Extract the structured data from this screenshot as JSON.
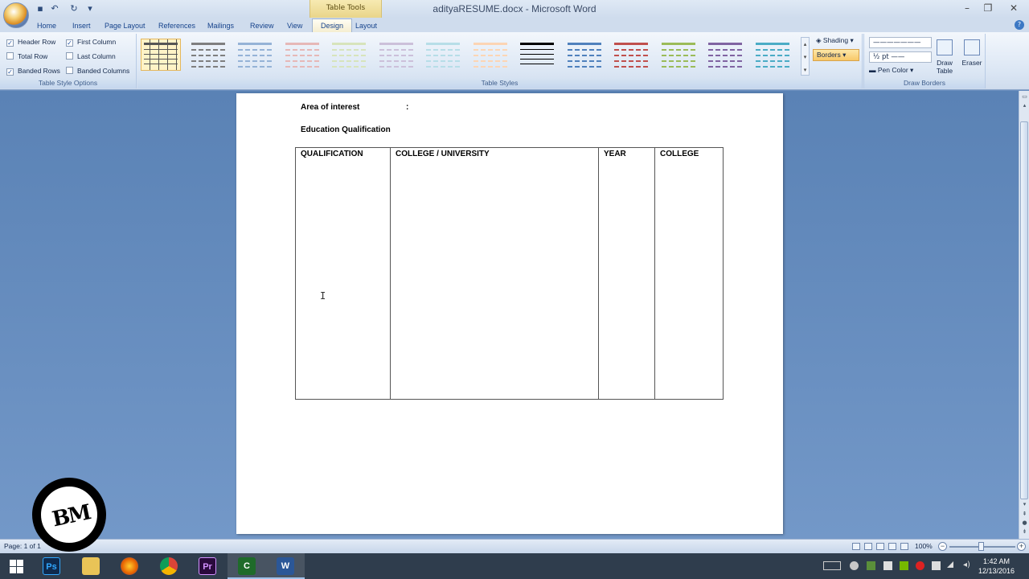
{
  "window": {
    "title": "adityaRESUME.docx - Microsoft Word",
    "contextual_tab_group": "Table Tools"
  },
  "tabs": [
    "Home",
    "Insert",
    "Page Layout",
    "References",
    "Mailings",
    "Review",
    "View",
    "Design",
    "Layout"
  ],
  "active_tab": "Design",
  "ribbon": {
    "table_style_options": {
      "label": "Table Style Options",
      "header_row": {
        "label": "Header Row",
        "checked": true
      },
      "first_column": {
        "label": "First Column",
        "checked": true
      },
      "total_row": {
        "label": "Total Row",
        "checked": false
      },
      "last_column": {
        "label": "Last Column",
        "checked": false
      },
      "banded_rows": {
        "label": "Banded Rows",
        "checked": true
      },
      "banded_columns": {
        "label": "Banded Columns",
        "checked": false
      }
    },
    "table_styles": {
      "label": "Table Styles",
      "colors": [
        "#555555",
        "#7f7f7f",
        "#95b3d7",
        "#e6b8b7",
        "#d7e4bc",
        "#ccc0da",
        "#b7dee8",
        "#fcd5b4",
        "#000000",
        "#4f81bd",
        "#c0504d",
        "#9bbb59",
        "#8064a2",
        "#4bacc6"
      ]
    },
    "shading_label": "Shading",
    "borders_label": "Borders",
    "line_weight": "½ pt",
    "pen_color_label": "Pen Color",
    "draw_table_label": "Draw Table",
    "eraser_label": "Eraser",
    "draw_borders_label": "Draw Borders"
  },
  "document": {
    "area_of_interest": "Area of interest",
    "colon": ":",
    "education_heading": "Education Qualification",
    "table_headers": [
      "QUALIFICATION",
      "COLLEGE / UNIVERSITY",
      "YEAR",
      "COLLEGE"
    ]
  },
  "statusbar": {
    "page": "Page: 1 of 1",
    "zoom": "100%"
  },
  "taskbar": {
    "apps": [
      "Ps",
      "Pr",
      "C",
      "W"
    ],
    "time": "1:42 AM",
    "date": "12/13/2016"
  },
  "watermark_text": "BM"
}
